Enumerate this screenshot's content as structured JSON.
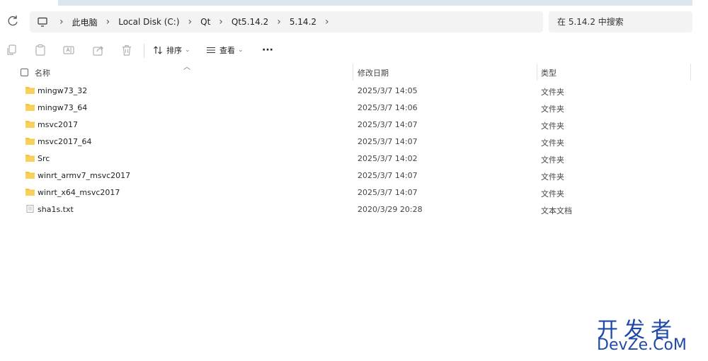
{
  "address": {
    "crumbs": [
      "此电脑",
      "Local Disk (C:)",
      "Qt",
      "Qt5.14.2",
      "5.14.2"
    ],
    "search_placeholder": "在 5.14.2 中搜索"
  },
  "toolbar": {
    "sort_label": "排序",
    "view_label": "查看",
    "more_label": "···"
  },
  "columns": {
    "name": "名称",
    "date": "修改日期",
    "type": "类型"
  },
  "files": [
    {
      "name": "mingw73_32",
      "date": "2025/3/7 14:05",
      "type": "文件夹",
      "icon": "folder-icon"
    },
    {
      "name": "mingw73_64",
      "date": "2025/3/7 14:06",
      "type": "文件夹",
      "icon": "folder-icon"
    },
    {
      "name": "msvc2017",
      "date": "2025/3/7 14:07",
      "type": "文件夹",
      "icon": "folder-icon"
    },
    {
      "name": "msvc2017_64",
      "date": "2025/3/7 14:07",
      "type": "文件夹",
      "icon": "folder-icon"
    },
    {
      "name": "Src",
      "date": "2025/3/7 14:02",
      "type": "文件夹",
      "icon": "folder-icon"
    },
    {
      "name": "winrt_armv7_msvc2017",
      "date": "2025/3/7 14:07",
      "type": "文件夹",
      "icon": "folder-icon"
    },
    {
      "name": "winrt_x64_msvc2017",
      "date": "2025/3/7 14:07",
      "type": "文件夹",
      "icon": "folder-icon"
    },
    {
      "name": "sha1s.txt",
      "date": "2020/3/29 20:28",
      "type": "文本文档",
      "icon": "text-file-icon"
    }
  ],
  "watermark": {
    "cn": "开发者",
    "en": "DevZe.CoM"
  },
  "colors": {
    "folder": "#f5c242",
    "accent_strip": "#dbe6ef",
    "watermark": "#1f4aa8"
  }
}
